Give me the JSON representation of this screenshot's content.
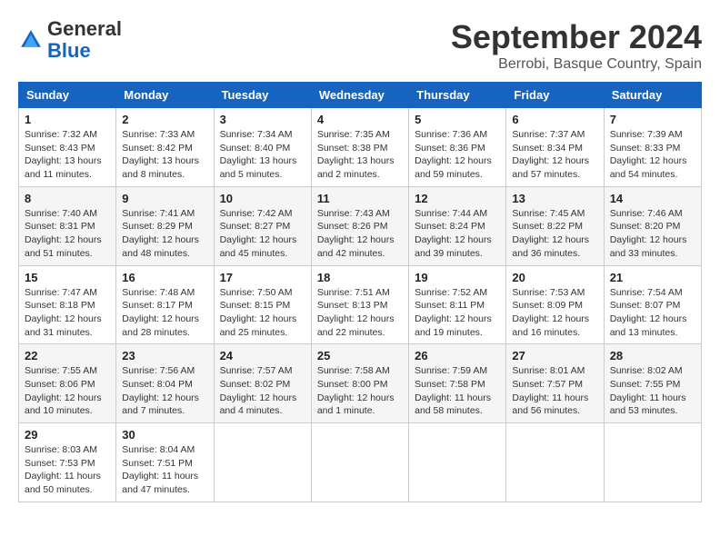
{
  "header": {
    "logo_general": "General",
    "logo_blue": "Blue",
    "month_title": "September 2024",
    "location": "Berrobi, Basque Country, Spain"
  },
  "columns": [
    "Sunday",
    "Monday",
    "Tuesday",
    "Wednesday",
    "Thursday",
    "Friday",
    "Saturday"
  ],
  "weeks": [
    [
      {
        "day": "1",
        "info": "Sunrise: 7:32 AM\nSunset: 8:43 PM\nDaylight: 13 hours and 11 minutes."
      },
      {
        "day": "2",
        "info": "Sunrise: 7:33 AM\nSunset: 8:42 PM\nDaylight: 13 hours and 8 minutes."
      },
      {
        "day": "3",
        "info": "Sunrise: 7:34 AM\nSunset: 8:40 PM\nDaylight: 13 hours and 5 minutes."
      },
      {
        "day": "4",
        "info": "Sunrise: 7:35 AM\nSunset: 8:38 PM\nDaylight: 13 hours and 2 minutes."
      },
      {
        "day": "5",
        "info": "Sunrise: 7:36 AM\nSunset: 8:36 PM\nDaylight: 12 hours and 59 minutes."
      },
      {
        "day": "6",
        "info": "Sunrise: 7:37 AM\nSunset: 8:34 PM\nDaylight: 12 hours and 57 minutes."
      },
      {
        "day": "7",
        "info": "Sunrise: 7:39 AM\nSunset: 8:33 PM\nDaylight: 12 hours and 54 minutes."
      }
    ],
    [
      {
        "day": "8",
        "info": "Sunrise: 7:40 AM\nSunset: 8:31 PM\nDaylight: 12 hours and 51 minutes."
      },
      {
        "day": "9",
        "info": "Sunrise: 7:41 AM\nSunset: 8:29 PM\nDaylight: 12 hours and 48 minutes."
      },
      {
        "day": "10",
        "info": "Sunrise: 7:42 AM\nSunset: 8:27 PM\nDaylight: 12 hours and 45 minutes."
      },
      {
        "day": "11",
        "info": "Sunrise: 7:43 AM\nSunset: 8:26 PM\nDaylight: 12 hours and 42 minutes."
      },
      {
        "day": "12",
        "info": "Sunrise: 7:44 AM\nSunset: 8:24 PM\nDaylight: 12 hours and 39 minutes."
      },
      {
        "day": "13",
        "info": "Sunrise: 7:45 AM\nSunset: 8:22 PM\nDaylight: 12 hours and 36 minutes."
      },
      {
        "day": "14",
        "info": "Sunrise: 7:46 AM\nSunset: 8:20 PM\nDaylight: 12 hours and 33 minutes."
      }
    ],
    [
      {
        "day": "15",
        "info": "Sunrise: 7:47 AM\nSunset: 8:18 PM\nDaylight: 12 hours and 31 minutes."
      },
      {
        "day": "16",
        "info": "Sunrise: 7:48 AM\nSunset: 8:17 PM\nDaylight: 12 hours and 28 minutes."
      },
      {
        "day": "17",
        "info": "Sunrise: 7:50 AM\nSunset: 8:15 PM\nDaylight: 12 hours and 25 minutes."
      },
      {
        "day": "18",
        "info": "Sunrise: 7:51 AM\nSunset: 8:13 PM\nDaylight: 12 hours and 22 minutes."
      },
      {
        "day": "19",
        "info": "Sunrise: 7:52 AM\nSunset: 8:11 PM\nDaylight: 12 hours and 19 minutes."
      },
      {
        "day": "20",
        "info": "Sunrise: 7:53 AM\nSunset: 8:09 PM\nDaylight: 12 hours and 16 minutes."
      },
      {
        "day": "21",
        "info": "Sunrise: 7:54 AM\nSunset: 8:07 PM\nDaylight: 12 hours and 13 minutes."
      }
    ],
    [
      {
        "day": "22",
        "info": "Sunrise: 7:55 AM\nSunset: 8:06 PM\nDaylight: 12 hours and 10 minutes."
      },
      {
        "day": "23",
        "info": "Sunrise: 7:56 AM\nSunset: 8:04 PM\nDaylight: 12 hours and 7 minutes."
      },
      {
        "day": "24",
        "info": "Sunrise: 7:57 AM\nSunset: 8:02 PM\nDaylight: 12 hours and 4 minutes."
      },
      {
        "day": "25",
        "info": "Sunrise: 7:58 AM\nSunset: 8:00 PM\nDaylight: 12 hours and 1 minute."
      },
      {
        "day": "26",
        "info": "Sunrise: 7:59 AM\nSunset: 7:58 PM\nDaylight: 11 hours and 58 minutes."
      },
      {
        "day": "27",
        "info": "Sunrise: 8:01 AM\nSunset: 7:57 PM\nDaylight: 11 hours and 56 minutes."
      },
      {
        "day": "28",
        "info": "Sunrise: 8:02 AM\nSunset: 7:55 PM\nDaylight: 11 hours and 53 minutes."
      }
    ],
    [
      {
        "day": "29",
        "info": "Sunrise: 8:03 AM\nSunset: 7:53 PM\nDaylight: 11 hours and 50 minutes."
      },
      {
        "day": "30",
        "info": "Sunrise: 8:04 AM\nSunset: 7:51 PM\nDaylight: 11 hours and 47 minutes."
      },
      null,
      null,
      null,
      null,
      null
    ]
  ]
}
